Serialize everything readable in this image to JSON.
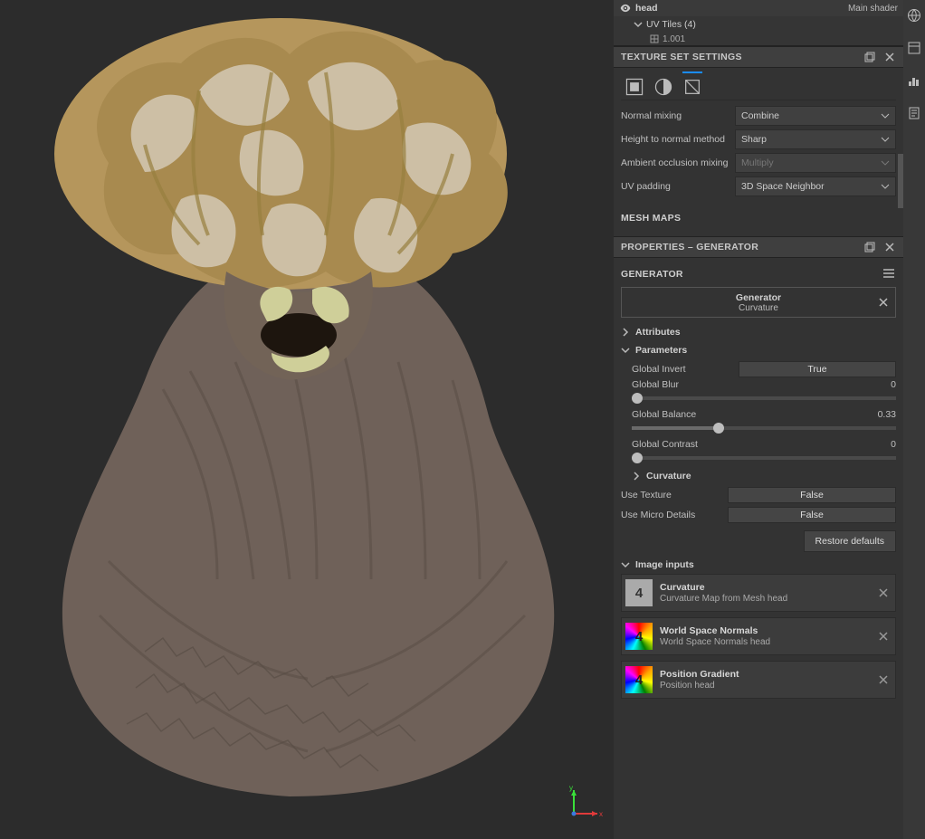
{
  "layers": {
    "head_label": "head",
    "shader_label": "Main shader",
    "uv_tiles_label": "UV Tiles (4)",
    "uv_child": "1.001"
  },
  "texture_set": {
    "panel_title": "TEXTURE SET SETTINGS",
    "rows": {
      "normal_mixing_label": "Normal mixing",
      "normal_mixing_value": "Combine",
      "height_method_label": "Height to normal method",
      "height_method_value": "Sharp",
      "ao_mixing_label": "Ambient occlusion mixing",
      "ao_mixing_value": "Multiply",
      "uv_padding_label": "UV padding",
      "uv_padding_value": "3D Space Neighbor"
    },
    "mesh_maps_label": "MESH MAPS"
  },
  "properties": {
    "panel_title": "PROPERTIES – GENERATOR",
    "section_label": "GENERATOR",
    "generator_name": "Generator",
    "generator_sub": "Curvature",
    "attributes_label": "Attributes",
    "parameters_label": "Parameters",
    "global_invert_label": "Global Invert",
    "global_invert_value": "True",
    "global_blur_label": "Global Blur",
    "global_blur_value": "0",
    "global_balance_label": "Global Balance",
    "global_balance_value": "0.33",
    "global_contrast_label": "Global Contrast",
    "global_contrast_value": "0",
    "curvature_label": "Curvature",
    "use_texture_label": "Use Texture",
    "use_texture_value": "False",
    "use_micro_label": "Use Micro Details",
    "use_micro_value": "False",
    "restore_label": "Restore defaults",
    "image_inputs_label": "Image inputs",
    "inputs": {
      "curvature_name": "Curvature",
      "curvature_sub": "Curvature Map from Mesh head",
      "wsn_name": "World Space Normals",
      "wsn_sub": "World Space Normals head",
      "pos_name": "Position Gradient",
      "pos_sub": "Position head"
    }
  },
  "axis": {
    "x": "x",
    "y": "y"
  },
  "thumb_glyph": "4"
}
